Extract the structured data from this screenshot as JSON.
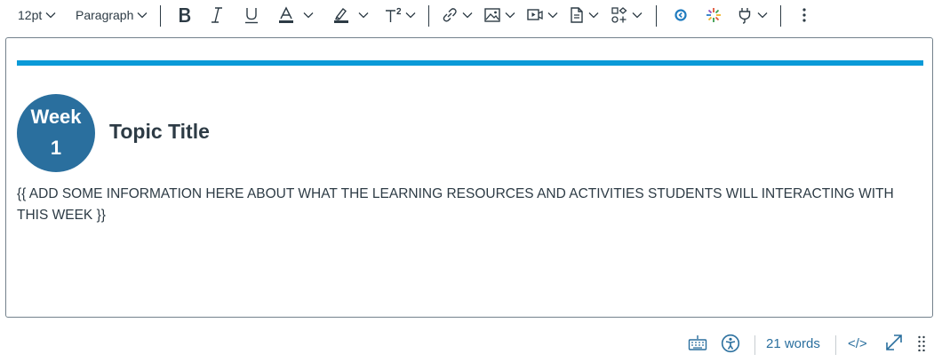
{
  "toolbar": {
    "font_size": "12pt",
    "block_format": "Paragraph"
  },
  "colors": {
    "accent_bar": "#0a9ad8",
    "badge_bg": "#2a6f9e",
    "link_blue": "#2a6f9e",
    "text": "#2d3b45"
  },
  "content": {
    "badge_week": "Week",
    "badge_number": "1",
    "topic_title": "Topic Title",
    "body": "{{ ADD SOME INFORMATION HERE ABOUT WHAT THE LEARNING RESOURCES AND ACTIVITIES STUDENTS WILL INTERACTING WITH THIS WEEK }}"
  },
  "statusbar": {
    "word_count": "21 words",
    "html_toggle": "</>"
  },
  "icons": {
    "bold": "bold-icon",
    "italic": "italic-icon",
    "underline": "underline-icon",
    "text_color": "text-color-icon",
    "highlight": "highlight-icon",
    "superscript": "superscript-icon",
    "link": "link-icon",
    "image": "image-icon",
    "media": "media-icon",
    "document": "document-icon",
    "apps": "apps-icon",
    "equation": "equation-icon",
    "icon_maker": "icon-maker-icon",
    "plugin": "plugin-icon",
    "more": "more-icon",
    "keyboard": "keyboard-icon",
    "accessibility": "accessibility-icon",
    "fullscreen": "fullscreen-icon",
    "resize": "resize-handle-icon"
  }
}
